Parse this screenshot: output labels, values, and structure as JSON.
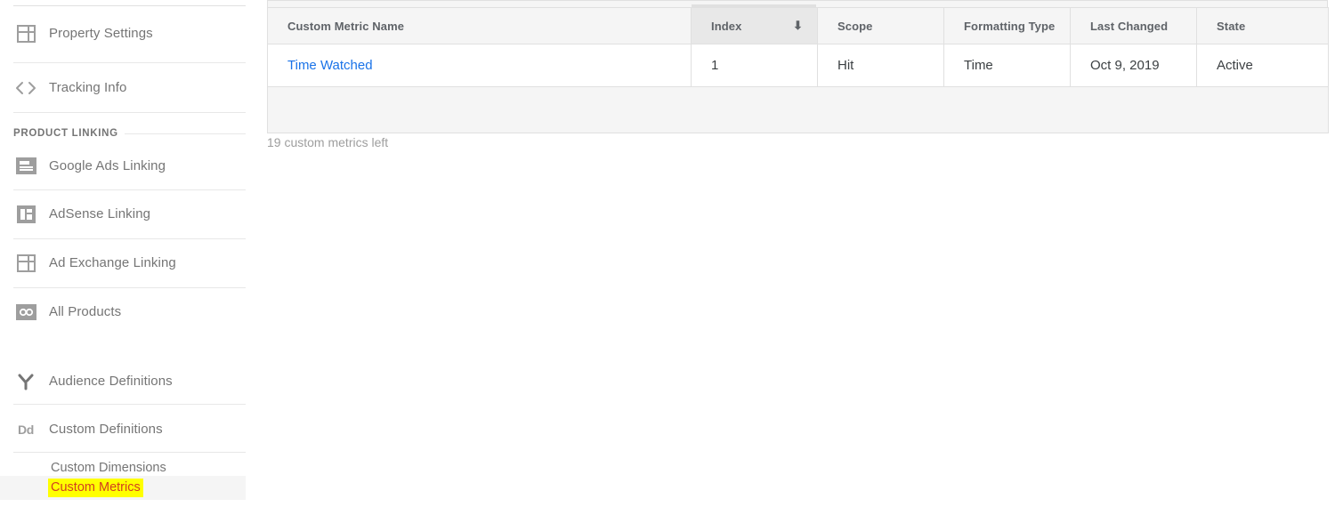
{
  "sidebar": {
    "items": [
      {
        "label": "Property Settings",
        "icon": "property-settings-icon"
      },
      {
        "label": "Tracking Info",
        "icon": "code-brackets-icon"
      }
    ],
    "section_product_linking": {
      "title": "PRODUCT LINKING",
      "items": [
        {
          "label": "Google Ads Linking",
          "icon": "google-ads-icon"
        },
        {
          "label": "AdSense Linking",
          "icon": "adsense-icon"
        },
        {
          "label": "Ad Exchange Linking",
          "icon": "ad-exchange-icon"
        },
        {
          "label": "All Products",
          "icon": "all-products-icon"
        }
      ]
    },
    "definitions": [
      {
        "label": "Audience Definitions",
        "icon": "audience-branch-icon"
      },
      {
        "label": "Custom Definitions",
        "icon": "dd-icon"
      }
    ],
    "sub_items": [
      {
        "label": "Custom Dimensions",
        "selected": false
      },
      {
        "label": "Custom Metrics",
        "selected": true
      }
    ],
    "highlight_color": "#ffff00",
    "highlight_text_color": "#d23f1f",
    "selected_row_bg": "#f5f5f5"
  },
  "table": {
    "columns": [
      {
        "key": "name",
        "label": "Custom Metric Name",
        "sorted": false
      },
      {
        "key": "index",
        "label": "Index",
        "sorted": true,
        "sort_icon": "arrow-down-icon",
        "sort_glyph": "⬇"
      },
      {
        "key": "scope",
        "label": "Scope",
        "sorted": false
      },
      {
        "key": "formatting_type",
        "label": "Formatting Type",
        "sorted": false
      },
      {
        "key": "last_changed",
        "label": "Last Changed",
        "sorted": false
      },
      {
        "key": "state",
        "label": "State",
        "sorted": false
      }
    ],
    "rows": [
      {
        "name": "Time Watched",
        "index": "1",
        "scope": "Hit",
        "formatting_type": "Time",
        "last_changed": "Oct 9, 2019",
        "state": "Active"
      }
    ],
    "footer_note": "19 custom metrics left",
    "link_color": "#1a73e8",
    "header_bg": "#f5f5f5",
    "sorted_header_bg": "#e8e8e8"
  }
}
